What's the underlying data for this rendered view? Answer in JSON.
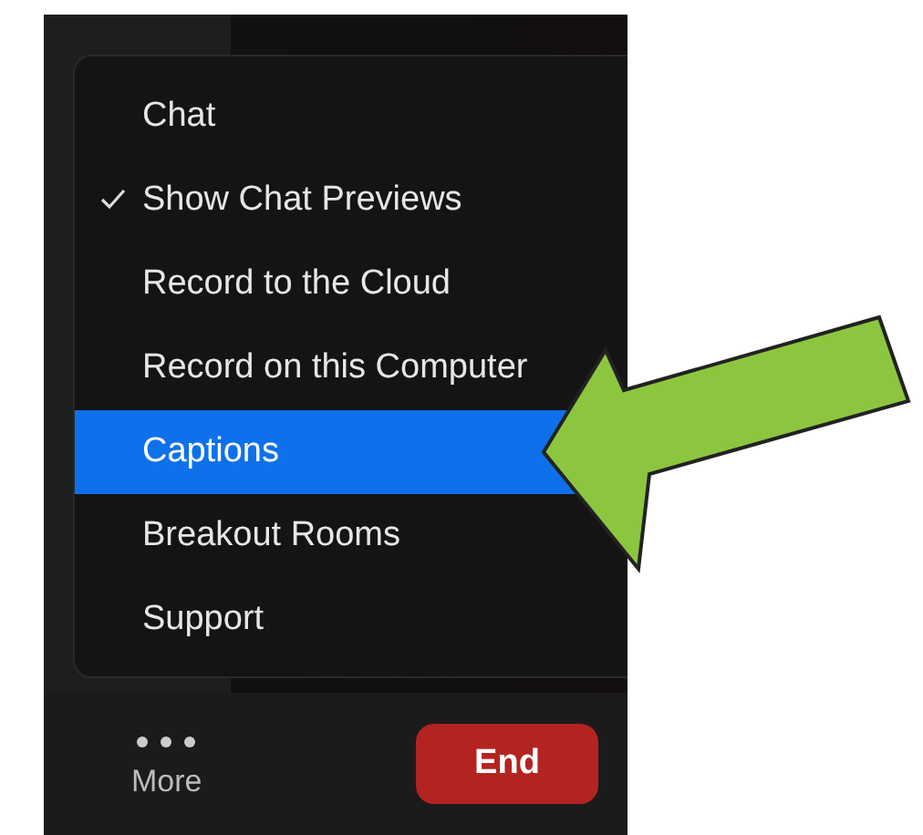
{
  "menu": {
    "items": [
      {
        "label": "Chat",
        "checked": false,
        "selected": false
      },
      {
        "label": "Show Chat Previews",
        "checked": true,
        "selected": false
      },
      {
        "label": "Record to the Cloud",
        "checked": false,
        "selected": false
      },
      {
        "label": "Record on this Computer",
        "checked": false,
        "selected": false
      },
      {
        "label": "Captions",
        "checked": false,
        "selected": true
      },
      {
        "label": "Breakout Rooms",
        "checked": false,
        "selected": false
      },
      {
        "label": "Support",
        "checked": false,
        "selected": false
      }
    ]
  },
  "toolbar": {
    "more": {
      "label": "More"
    },
    "end": {
      "label": "End"
    }
  }
}
